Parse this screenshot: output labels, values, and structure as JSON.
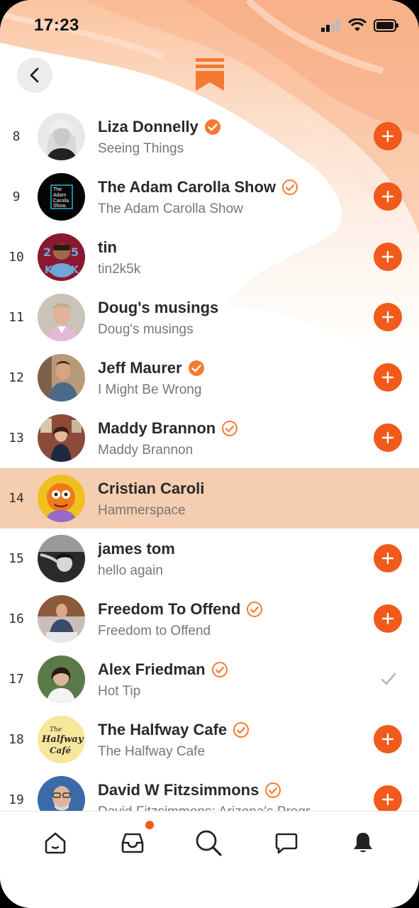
{
  "status_bar": {
    "time": "17:23"
  },
  "header": {
    "back_icon": "chevron-left-icon",
    "logo_icon": "substack-logo-icon"
  },
  "colors": {
    "accent": "#f15a1a",
    "highlight": "#f5cdb0",
    "wave": "#fbc9a8"
  },
  "rows": [
    {
      "rank": "8",
      "name": "Liza Donnelly",
      "subtitle": "Seeing Things",
      "verified": "filled",
      "action": "add"
    },
    {
      "rank": "9",
      "name": "The Adam Carolla Show",
      "subtitle": "The Adam Carolla Show",
      "verified": "outline",
      "action": "add",
      "avatar_text": [
        "The",
        "Adam",
        "Carolla",
        "Show."
      ]
    },
    {
      "rank": "10",
      "name": "tin",
      "subtitle": "tin2k5k",
      "verified": "none",
      "action": "add",
      "avatar_text": [
        "2",
        "5",
        "K",
        "K"
      ]
    },
    {
      "rank": "11",
      "name": "Doug's musings",
      "subtitle": "Doug's musings",
      "verified": "none",
      "action": "add"
    },
    {
      "rank": "12",
      "name": "Jeff Maurer",
      "subtitle": "I Might Be Wrong",
      "verified": "filled",
      "action": "add"
    },
    {
      "rank": "13",
      "name": "Maddy Brannon",
      "subtitle": "Maddy Brannon",
      "verified": "outline",
      "action": "add"
    },
    {
      "rank": "14",
      "name": "Cristian Caroli",
      "subtitle": "Hammerspace",
      "verified": "none",
      "action": "none",
      "highlighted": true
    },
    {
      "rank": "15",
      "name": "james tom",
      "subtitle": "hello again",
      "verified": "none",
      "action": "add"
    },
    {
      "rank": "16",
      "name": "Freedom To Offend",
      "subtitle": "Freedom to Offend",
      "verified": "outline",
      "action": "add"
    },
    {
      "rank": "17",
      "name": "Alex Friedman",
      "subtitle": "Hot Tip",
      "verified": "outline",
      "action": "subscribed"
    },
    {
      "rank": "18",
      "name": "The Halfway Cafe",
      "subtitle": "The Halfway Cafe",
      "verified": "outline",
      "action": "add",
      "avatar_text": [
        "The",
        "Halfway",
        "Café"
      ]
    },
    {
      "rank": "19",
      "name": "David W Fitzsimmons",
      "subtitle": "David Fitzsimmons: Arizona's Progr",
      "verified": "outline",
      "action": "add"
    }
  ],
  "tabbar": {
    "tabs": [
      "home-icon",
      "inbox-icon",
      "search-icon",
      "chat-icon",
      "bell-icon"
    ],
    "inbox_has_badge": true
  }
}
